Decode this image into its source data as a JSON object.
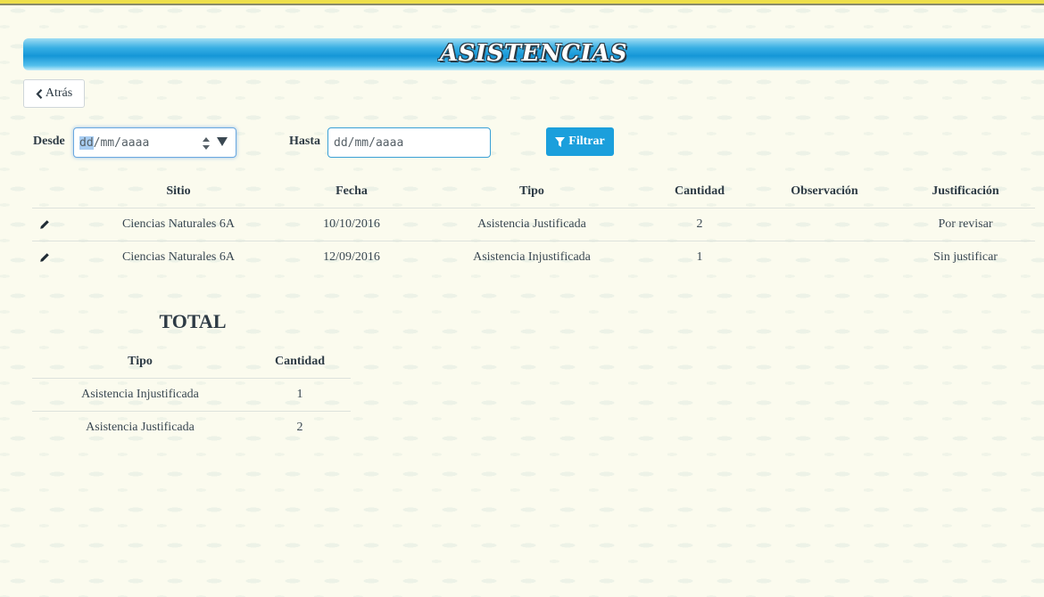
{
  "page": {
    "title": "ASISTENCIAS",
    "back_label": "Atrás"
  },
  "filters": {
    "desde_label": "Desde",
    "desde_day": "dd",
    "desde_rest": "/mm/aaaa",
    "hasta_label": "Hasta",
    "hasta_value": "dd/mm/aaaa",
    "filter_label": "Filtrar"
  },
  "table": {
    "headers": [
      "Sitio",
      "Fecha",
      "Tipo",
      "Cantidad",
      "Observación",
      "Justificación"
    ],
    "rows": [
      {
        "sitio": "Ciencias Naturales 6A",
        "fecha": "10/10/2016",
        "tipo": "Asistencia Justificada",
        "cantidad": "2",
        "observacion": "",
        "justificacion": "Por revisar"
      },
      {
        "sitio": "Ciencias Naturales 6A",
        "fecha": "12/09/2016",
        "tipo": "Asistencia Injustificada",
        "cantidad": "1",
        "observacion": "",
        "justificacion": "Sin justificar"
      }
    ]
  },
  "total": {
    "title": "TOTAL",
    "headers": [
      "Tipo",
      "Cantidad"
    ],
    "rows": [
      {
        "tipo": "Asistencia Injustificada",
        "cantidad": "1"
      },
      {
        "tipo": "Asistencia Justificada",
        "cantidad": "2"
      }
    ]
  },
  "icons": {
    "back": "chevron-left-icon",
    "filter": "filter-icon",
    "edit": "pencil-icon"
  },
  "colors": {
    "accent": "#1b9fdc",
    "banner": "#1596d7",
    "background": "#fbfbee"
  }
}
